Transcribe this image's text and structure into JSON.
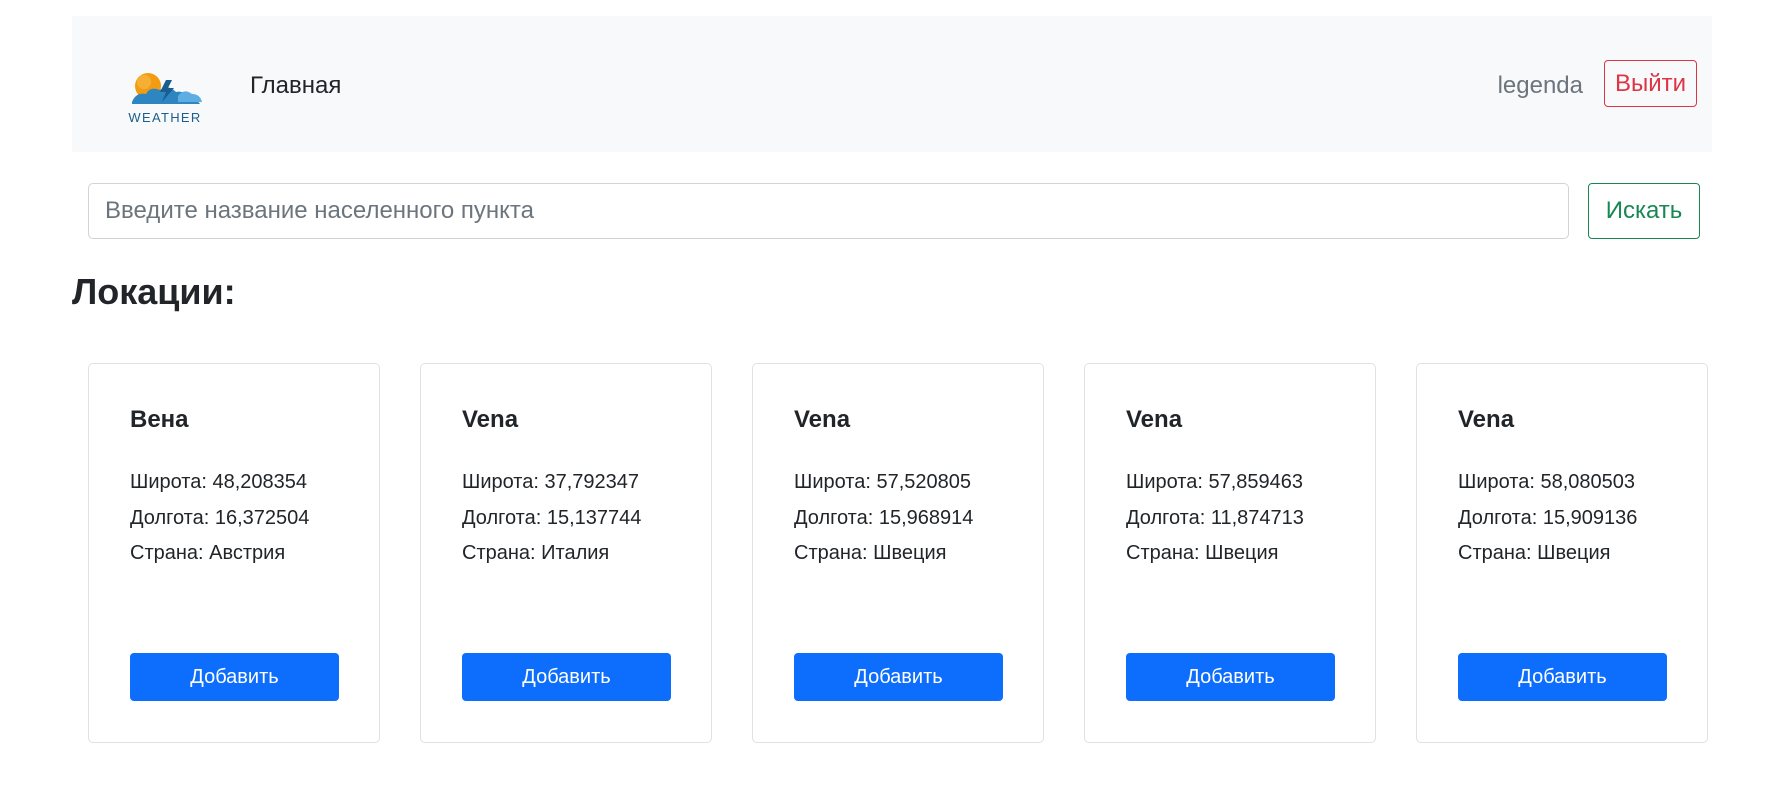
{
  "navbar": {
    "logo_text": "WEATHER",
    "home_label": "Главная",
    "username": "legenda",
    "logout_label": "Выйти"
  },
  "search": {
    "placeholder": "Введите название населенного пункта",
    "value": "",
    "button_label": "Искать"
  },
  "heading": "Локации:",
  "locations": [
    {
      "name": "Вена",
      "latitude": "Широта: 48,208354",
      "longitude": "Долгота: 16,372504",
      "country": "Страна: Австрия",
      "button_label": "Добавить"
    },
    {
      "name": "Vena",
      "latitude": "Широта: 37,792347",
      "longitude": "Долгота: 15,137744",
      "country": "Страна: Италия",
      "button_label": "Добавить"
    },
    {
      "name": "Vena",
      "latitude": "Широта: 57,520805",
      "longitude": "Долгота: 15,968914",
      "country": "Страна: Швеция",
      "button_label": "Добавить"
    },
    {
      "name": "Vena",
      "latitude": "Широта: 57,859463",
      "longitude": "Долгота: 11,874713",
      "country": "Страна: Швеция",
      "button_label": "Добавить"
    },
    {
      "name": "Vena",
      "latitude": "Широта: 58,080503",
      "longitude": "Долгота: 15,909136",
      "country": "Страна: Швеция",
      "button_label": "Добавить"
    }
  ],
  "colors": {
    "navbar_bg": "#f8f9fa",
    "primary": "#0d6efd",
    "success": "#198754",
    "danger": "#dc3545",
    "muted": "#6c757d"
  }
}
